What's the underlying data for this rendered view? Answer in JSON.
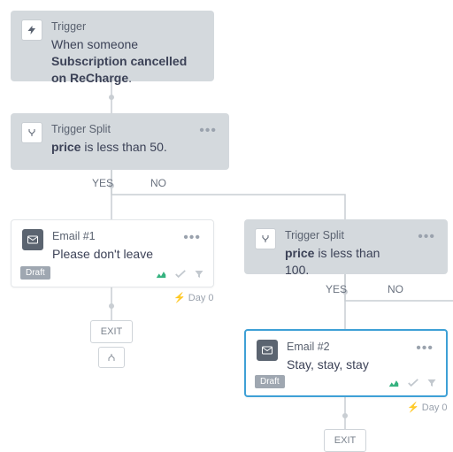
{
  "trigger": {
    "title": "Trigger",
    "sub_prefix": "When someone ",
    "sub_bold": "Subscription cancelled on ReCharge",
    "sub_suffix": "."
  },
  "split1": {
    "title": "Trigger Split",
    "field": "price",
    "rest": " is less than 50."
  },
  "split2": {
    "title": "Trigger Split",
    "field": "price",
    "rest": " is less than 100."
  },
  "email1": {
    "title": "Email #1",
    "subject": "Please don't leave",
    "status": "Draft"
  },
  "email2": {
    "title": "Email #2",
    "subject": "Stay, stay, stay",
    "status": "Draft"
  },
  "labels": {
    "yes": "YES",
    "no": "NO",
    "day0": "⚡ Day 0",
    "exit": "EXIT"
  }
}
